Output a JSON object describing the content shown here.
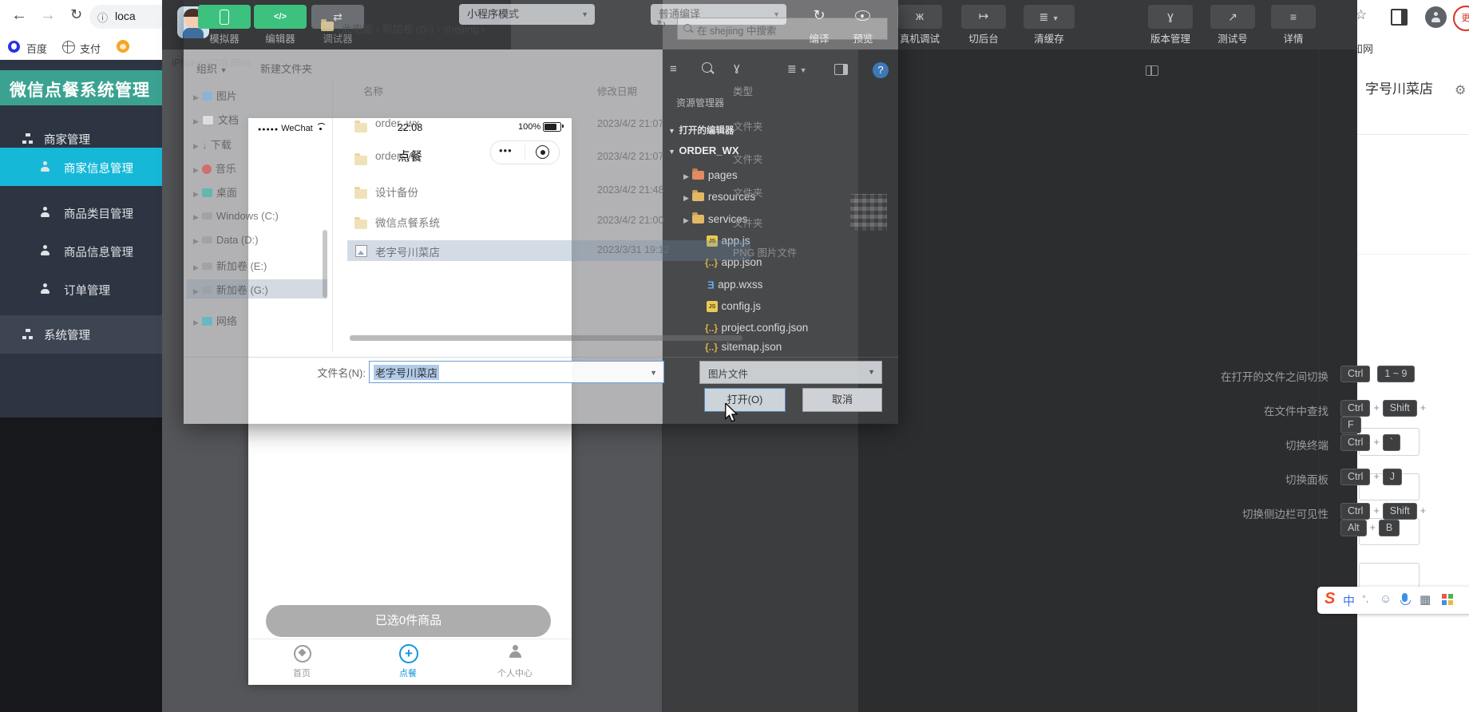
{
  "browser": {
    "url": "loca",
    "bookmarks": {
      "baidu": "百度",
      "zhifu": "支付",
      "right": "知网"
    },
    "page": {
      "title_tail": "字号川菜店"
    }
  },
  "admin": {
    "title": "微信点餐系统管理",
    "g1": "商家管理",
    "i1": "商家信息管理",
    "i2": "商品类目管理",
    "i3": "商品信息管理",
    "i4": "订单管理",
    "g2": "系统管理",
    "accent": "#16b8d8",
    "header_color": "#3ba291"
  },
  "devtools": {
    "toolbar": {
      "simulator": "模拟器",
      "editor": "编辑器",
      "debugger": "调试器",
      "mode": "小程序模式",
      "compile_mode": "普通编译",
      "compile": "编译",
      "preview": "预览",
      "real_device": "真机调试",
      "to_background": "切后台",
      "clear_cache": "清缓存",
      "version": "版本管理",
      "test_account": "测试号",
      "details": "详情"
    }
  },
  "simulator": {
    "device": "iPhone 6/7/8 85%",
    "carrier": "WeChat",
    "time": "22:08",
    "battery": "100%",
    "nav_title": "点餐",
    "selected_button": "已选0件商品",
    "tab1": "首页",
    "tab2": "点餐",
    "tab3": "个人中心",
    "tab_accent": "#1296db"
  },
  "explorer": {
    "title": "资源管理器",
    "open_editors": "打开的编辑器",
    "project": "ORDER_WX",
    "n1": "pages",
    "n2": "resources",
    "n3": "services",
    "n4": "app.js",
    "n5": "app.json",
    "n6": "app.wxss",
    "n7": "config.js",
    "n8": "project.config.json",
    "n9": "sitemap.json"
  },
  "shortcuts": {
    "plus": "+",
    "s1": {
      "label": "在打开的文件之间切换",
      "k1": "Ctrl",
      "k2": "1 ~ 9"
    },
    "s2": {
      "label": "在文件中查找",
      "k1": "Ctrl",
      "k2": "Shift",
      "k3": "F"
    },
    "s3": {
      "label": "切换终端",
      "k1": "Ctrl",
      "k2": "`"
    },
    "s4": {
      "label": "切换面板",
      "k1": "Ctrl",
      "k2": "J"
    },
    "s5": {
      "label": "切换侧边栏可见性",
      "k1": "Ctrl",
      "k2": "Shift",
      "k3": "Alt",
      "k4": "B"
    }
  },
  "dialog": {
    "b1": "此电脑",
    "b2": "新加卷 (G:)",
    "b3": "shejiing",
    "search": "在 shejiing 中搜索",
    "organize": "组织",
    "new_folder": "新建文件夹",
    "col_name": "名称",
    "col_date": "修改日期",
    "col_type": "类型",
    "nav1": "图片",
    "nav2": "文档",
    "nav3": "下载",
    "nav4": "音乐",
    "nav5": "桌面",
    "nav6": "Windows (C:)",
    "nav7": "Data (D:)",
    "nav8": "新加卷 (E:)",
    "nav9": "新加卷 (G:)",
    "nav10": "网络",
    "f1": {
      "name": "order_wx",
      "date": "2023/4/2 21:07",
      "type": "文件夹"
    },
    "f2": {
      "name": "ordersys",
      "date": "2023/4/2 21:07",
      "type": "文件夹"
    },
    "f3": {
      "name": "设计备份",
      "date": "2023/4/2 21:48",
      "type": "文件夹"
    },
    "f4": {
      "name": "微信点餐系统",
      "date": "2023/4/2 21:00",
      "type": "文件夹"
    },
    "f5": {
      "name": "老字号川菜店",
      "date": "2023/3/31 19:12",
      "type": "PNG 图片文件"
    },
    "filename_label": "文件名(N):",
    "filename": "老字号川菜店",
    "filetype": "图片文件",
    "open": "打开(O)",
    "cancel": "取消"
  },
  "ime": {
    "logo": "S",
    "lang": "中"
  }
}
